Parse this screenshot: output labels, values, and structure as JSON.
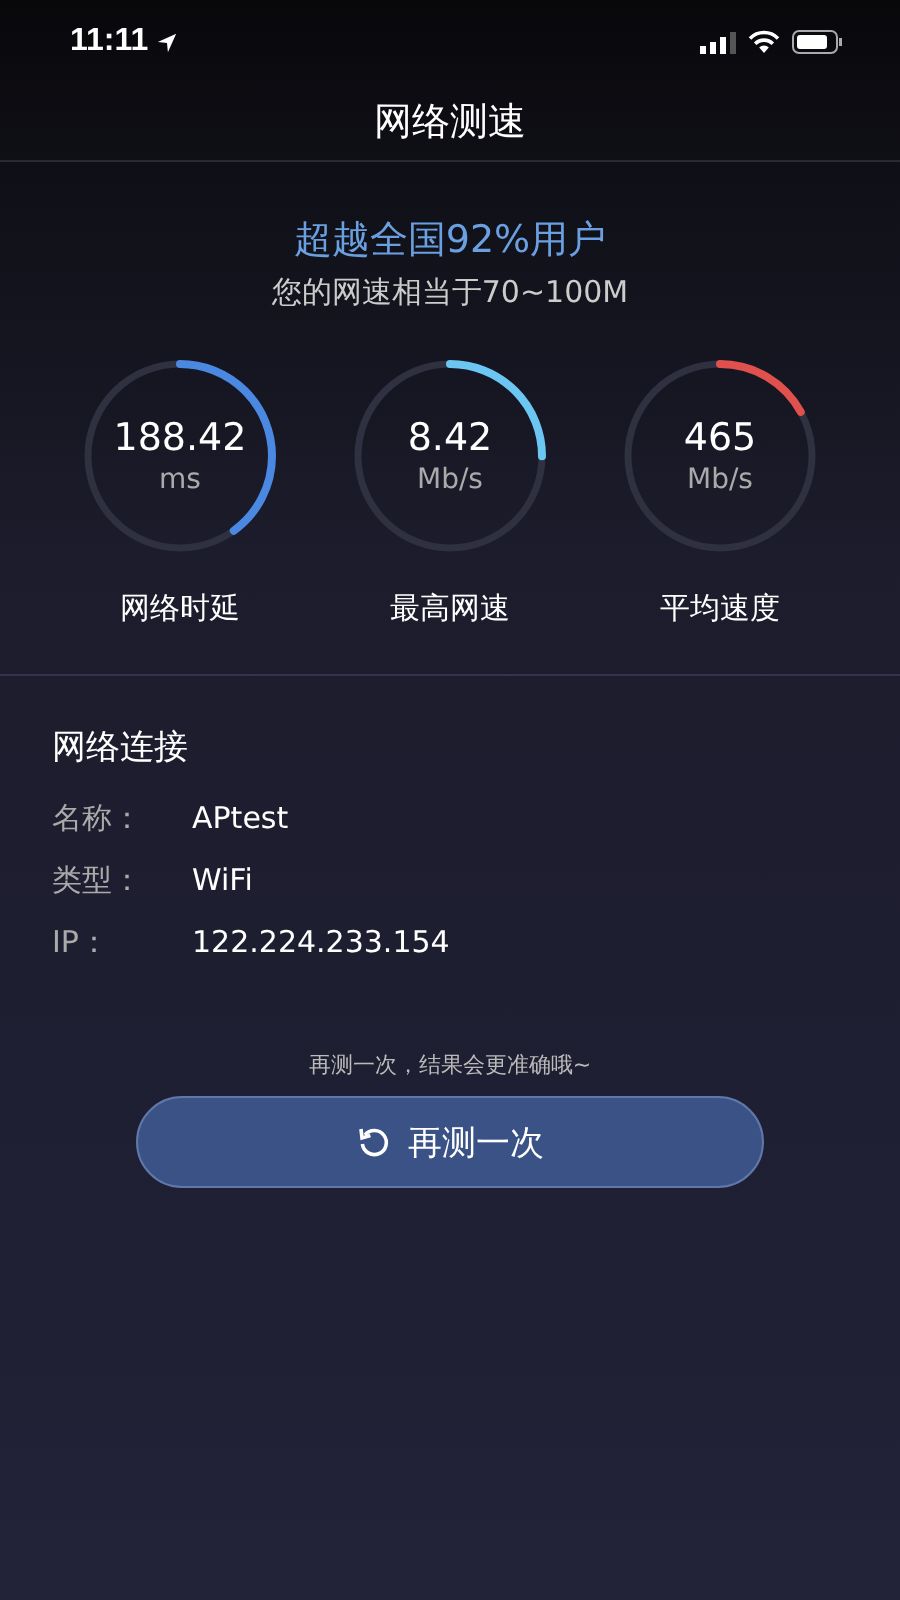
{
  "status_bar": {
    "time": "11:11"
  },
  "title": "网络测速",
  "summary": {
    "headline": "超越全国92%用户",
    "subtitle": "您的网速相当于70~100M"
  },
  "gauges": [
    {
      "value": "188.42",
      "unit": "ms",
      "label": "网络时延",
      "level": 0.4,
      "color": "#4a88e2"
    },
    {
      "value": "8.42",
      "unit": "Mb/s",
      "label": "最高网速",
      "level": 0.25,
      "color": "#6cc6f2"
    },
    {
      "value": "465",
      "unit": "Mb/s",
      "label": "平均速度",
      "level": 0.17,
      "color": "#e0504c"
    }
  ],
  "connection": {
    "title": "网络连接",
    "rows": [
      {
        "label": "名称：",
        "value": "APtest"
      },
      {
        "label": "类型：",
        "value": "WiFi"
      },
      {
        "label": "IP：",
        "value": "122.224.233.154"
      }
    ]
  },
  "hint": "再测一次，结果会更准确哦~",
  "retest_button": "再测一次"
}
